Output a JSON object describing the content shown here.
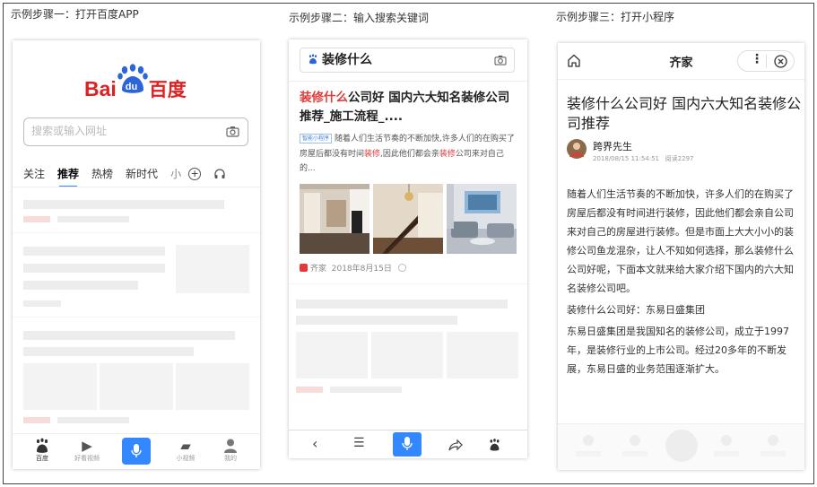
{
  "steps": {
    "step1": "示例步骤一：打开百度APP",
    "step2": "示例步骤二：输入搜索关键词",
    "step3": "示例步骤三：打开小程序"
  },
  "phone1": {
    "logo_left": "Bai",
    "logo_mid": "du",
    "logo_right": "百度",
    "search_placeholder": "搜索或输入网址",
    "tabs": [
      "关注",
      "推荐",
      "热榜",
      "新时代",
      "小"
    ],
    "bottom_nav": [
      "百度",
      "好看视频",
      "",
      "小视频",
      "我的"
    ]
  },
  "phone2": {
    "search_value": "装修什么",
    "result_title_red": "装修什么",
    "result_title_rest": "公司好 国内六大知名装修公司推荐_施工流程_....",
    "tag": "智能小程序",
    "desc_parts": [
      "随着人们生活节奏的不断加快,许多人们的在购买了房屋后都没有时间",
      "装修",
      ",因此他们都会亲",
      "装修",
      "公司来对自己的..."
    ],
    "source": "齐家",
    "date": "2018年8月15日"
  },
  "phone3": {
    "header_title": "齐家",
    "article_title": "装修什么公司好 国内六大知名装修公司推荐",
    "author": "跨界先生",
    "meta": "2018/08/15 11:54:51   阅读2297",
    "para1": "随着人们生活节奏的不断加快，许多人们的在购买了房屋后都没有时间进行装修，因此他们都会亲自公司来对自己的房屋进行装修。但是市面上大大小小的装修公司鱼龙混杂，让人不知如何选择，那么装修什么公司好呢，下面本文就来给大家介绍下国内的六大知名装修公司吧。",
    "para2": "装修什么公司好：东易日盛集团",
    "para3": "东易日盛集团是我国知名的装修公司，成立于1997年，是装修行业的上市公司。经过20多年的不断发展，东易日盛的业务范围逐渐扩大。"
  }
}
